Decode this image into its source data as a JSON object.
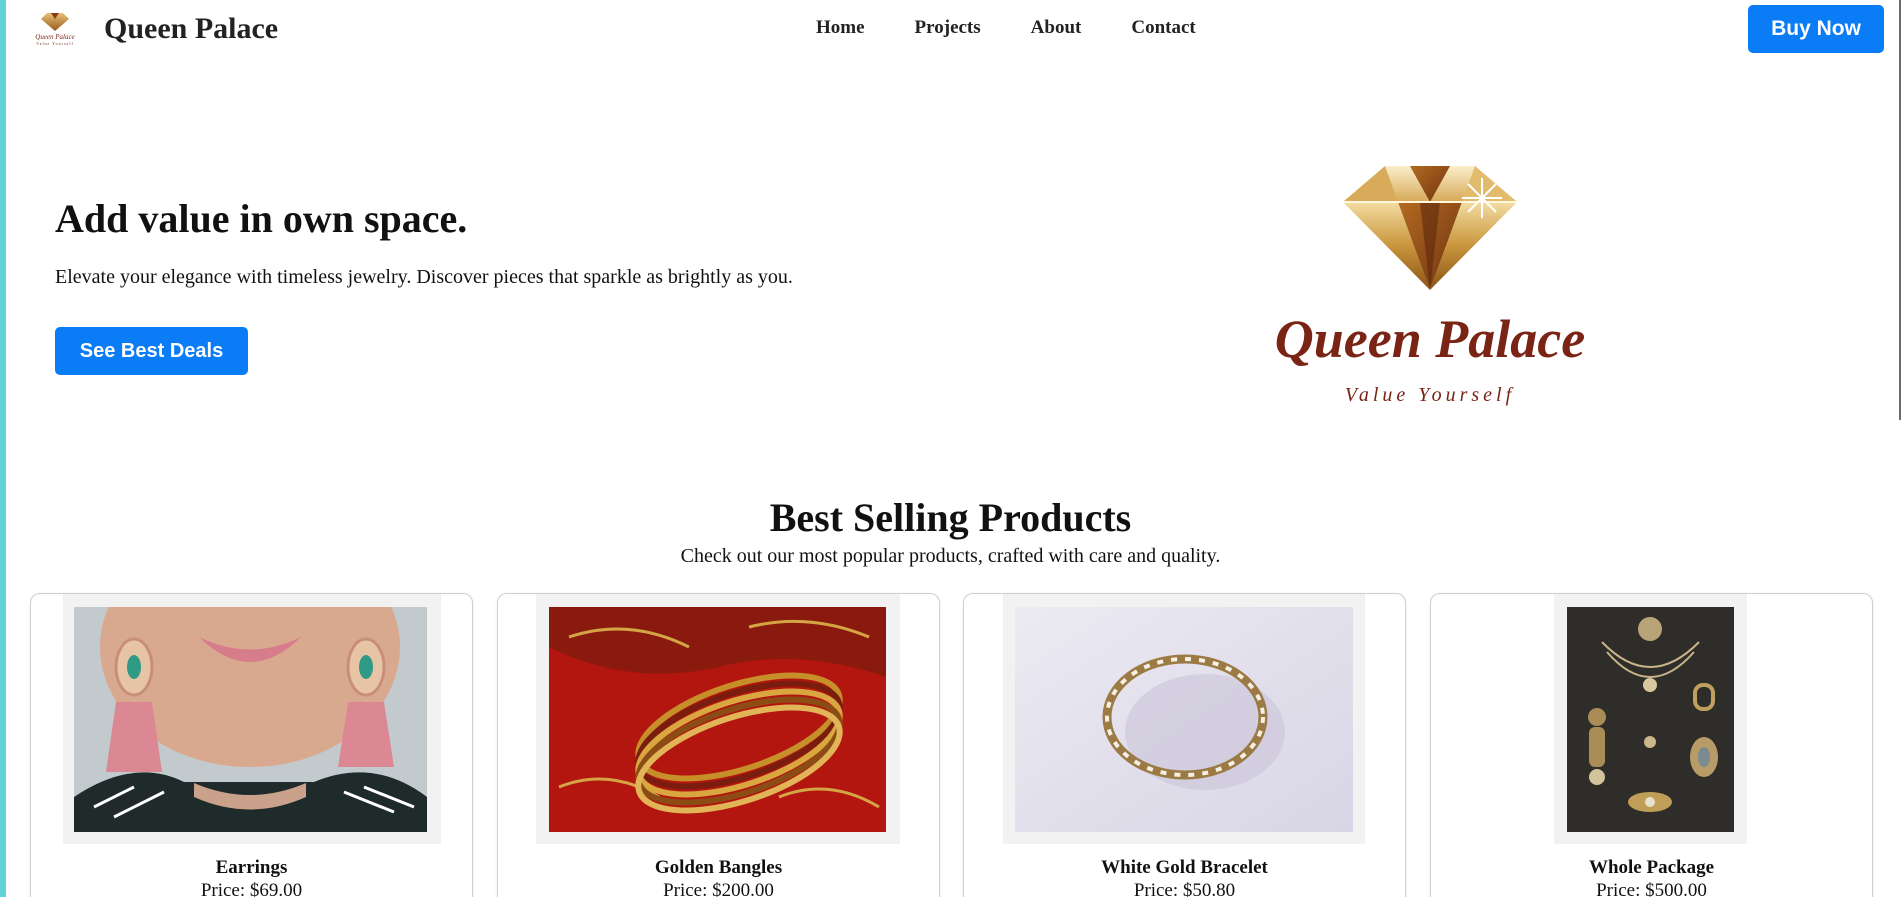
{
  "header": {
    "brand_name": "Queen Palace",
    "logo_mini_name": "Queen Palace",
    "logo_mini_tagline": "Value Yourself",
    "nav": [
      {
        "label": "Home"
      },
      {
        "label": "Projects"
      },
      {
        "label": "About"
      },
      {
        "label": "Contact"
      }
    ],
    "buy_label": "Buy Now"
  },
  "hero": {
    "title": "Add value in own space.",
    "text": "Elevate your elegance with timeless jewelry. Discover pieces that sparkle as brightly as you.",
    "cta_label": "See Best Deals",
    "logo_name": "Queen Palace",
    "logo_tagline": "Value Yourself"
  },
  "products": {
    "title": "Best Selling Products",
    "subtitle": "Check out our most popular products, crafted with care and quality.",
    "items": [
      {
        "name": "Earrings",
        "price": "Price: $69.00"
      },
      {
        "name": "Golden Bangles",
        "price": "Price: $200.00"
      },
      {
        "name": "White Gold Bracelet",
        "price": "Price: $50.80"
      },
      {
        "name": "Whole Package",
        "price": "Price: $500.00"
      }
    ]
  },
  "colors": {
    "accent": "#0a7cf5",
    "brand": "#7a2416",
    "gold": "#c9953c"
  }
}
